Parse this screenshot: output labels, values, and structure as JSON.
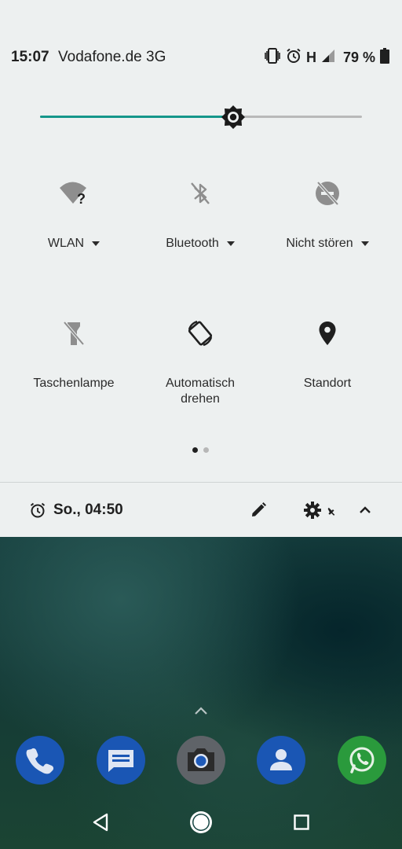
{
  "status_bar": {
    "time": "15:07",
    "carrier": "Vodafone.de 3G",
    "network_type": "H",
    "battery_percent": "79 %"
  },
  "brightness": {
    "level": 0.6
  },
  "tiles": [
    {
      "label": "WLAN",
      "icon": "wifi-unknown-icon",
      "has_dropdown": true
    },
    {
      "label": "Bluetooth",
      "icon": "bluetooth-off-icon",
      "has_dropdown": true
    },
    {
      "label": "Nicht stören",
      "icon": "do-not-disturb-off-icon",
      "has_dropdown": true
    },
    {
      "label": "Taschenlampe",
      "icon": "flashlight-off-icon"
    },
    {
      "label": "Automatisch\ndrehen",
      "label_line1": "Automatisch",
      "label_line2": "drehen",
      "icon": "auto-rotate-icon"
    },
    {
      "label": "Standort",
      "icon": "location-pin-icon"
    }
  ],
  "pages": {
    "current": 1,
    "total": 2
  },
  "footer": {
    "alarm": "So., 04:50"
  },
  "dock": [
    {
      "name": "phone",
      "icon": "phone-icon",
      "color": "#1a56b4"
    },
    {
      "name": "messages",
      "icon": "messages-icon",
      "color": "#1a56b4"
    },
    {
      "name": "camera",
      "icon": "camera-icon",
      "color": "#5f6368"
    },
    {
      "name": "contacts",
      "icon": "contacts-icon",
      "color": "#1a56b4"
    },
    {
      "name": "whatsapp",
      "icon": "whatsapp-icon",
      "color": "#2a9a3c"
    }
  ],
  "colors": {
    "accent": "#14968a",
    "panel_bg": "#edf0f0"
  }
}
